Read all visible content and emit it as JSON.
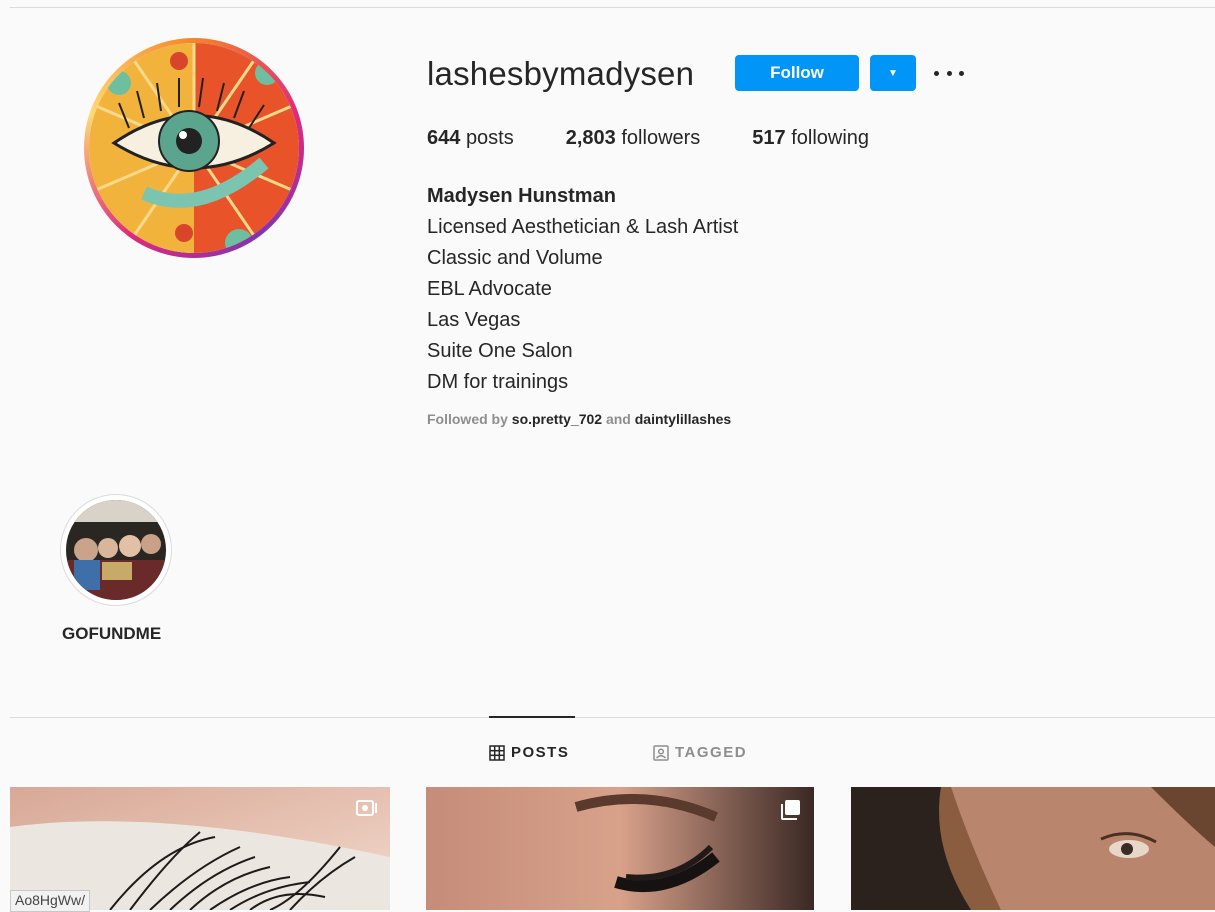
{
  "profile": {
    "username": "lashesbymadysen",
    "follow_label": "Follow",
    "stats": {
      "posts_count": "644",
      "posts_label": "posts",
      "followers_count": "2,803",
      "followers_label": "followers",
      "following_count": "517",
      "following_label": "following"
    },
    "bio": {
      "name": "Madysen Hunstman",
      "lines": [
        "Licensed Aesthetician & Lash Artist",
        "Classic and Volume",
        "EBL Advocate",
        "Las Vegas",
        "Suite One Salon",
        "DM for trainings"
      ]
    },
    "followed_by": {
      "prefix": "Followed by",
      "account_1": "so.pretty_702",
      "joiner": "and",
      "account_2": "daintylillashes"
    }
  },
  "highlights": [
    {
      "label": "GOFUNDME"
    }
  ],
  "tabs": [
    {
      "label": "POSTS",
      "icon": "grid-icon",
      "active": true
    },
    {
      "label": "TAGGED",
      "icon": "tagged-icon",
      "active": false
    }
  ],
  "posts": [
    {
      "type": "video",
      "badge_icon": "igtv-icon"
    },
    {
      "type": "carousel",
      "badge_icon": "carousel-icon"
    },
    {
      "type": "photo"
    }
  ],
  "status_url_text": "Ao8HgWw/",
  "colors": {
    "accent": "#0095f6",
    "text": "#262626",
    "muted": "#8e8e8e",
    "background": "#fafafa",
    "border": "#dbdbdb"
  }
}
